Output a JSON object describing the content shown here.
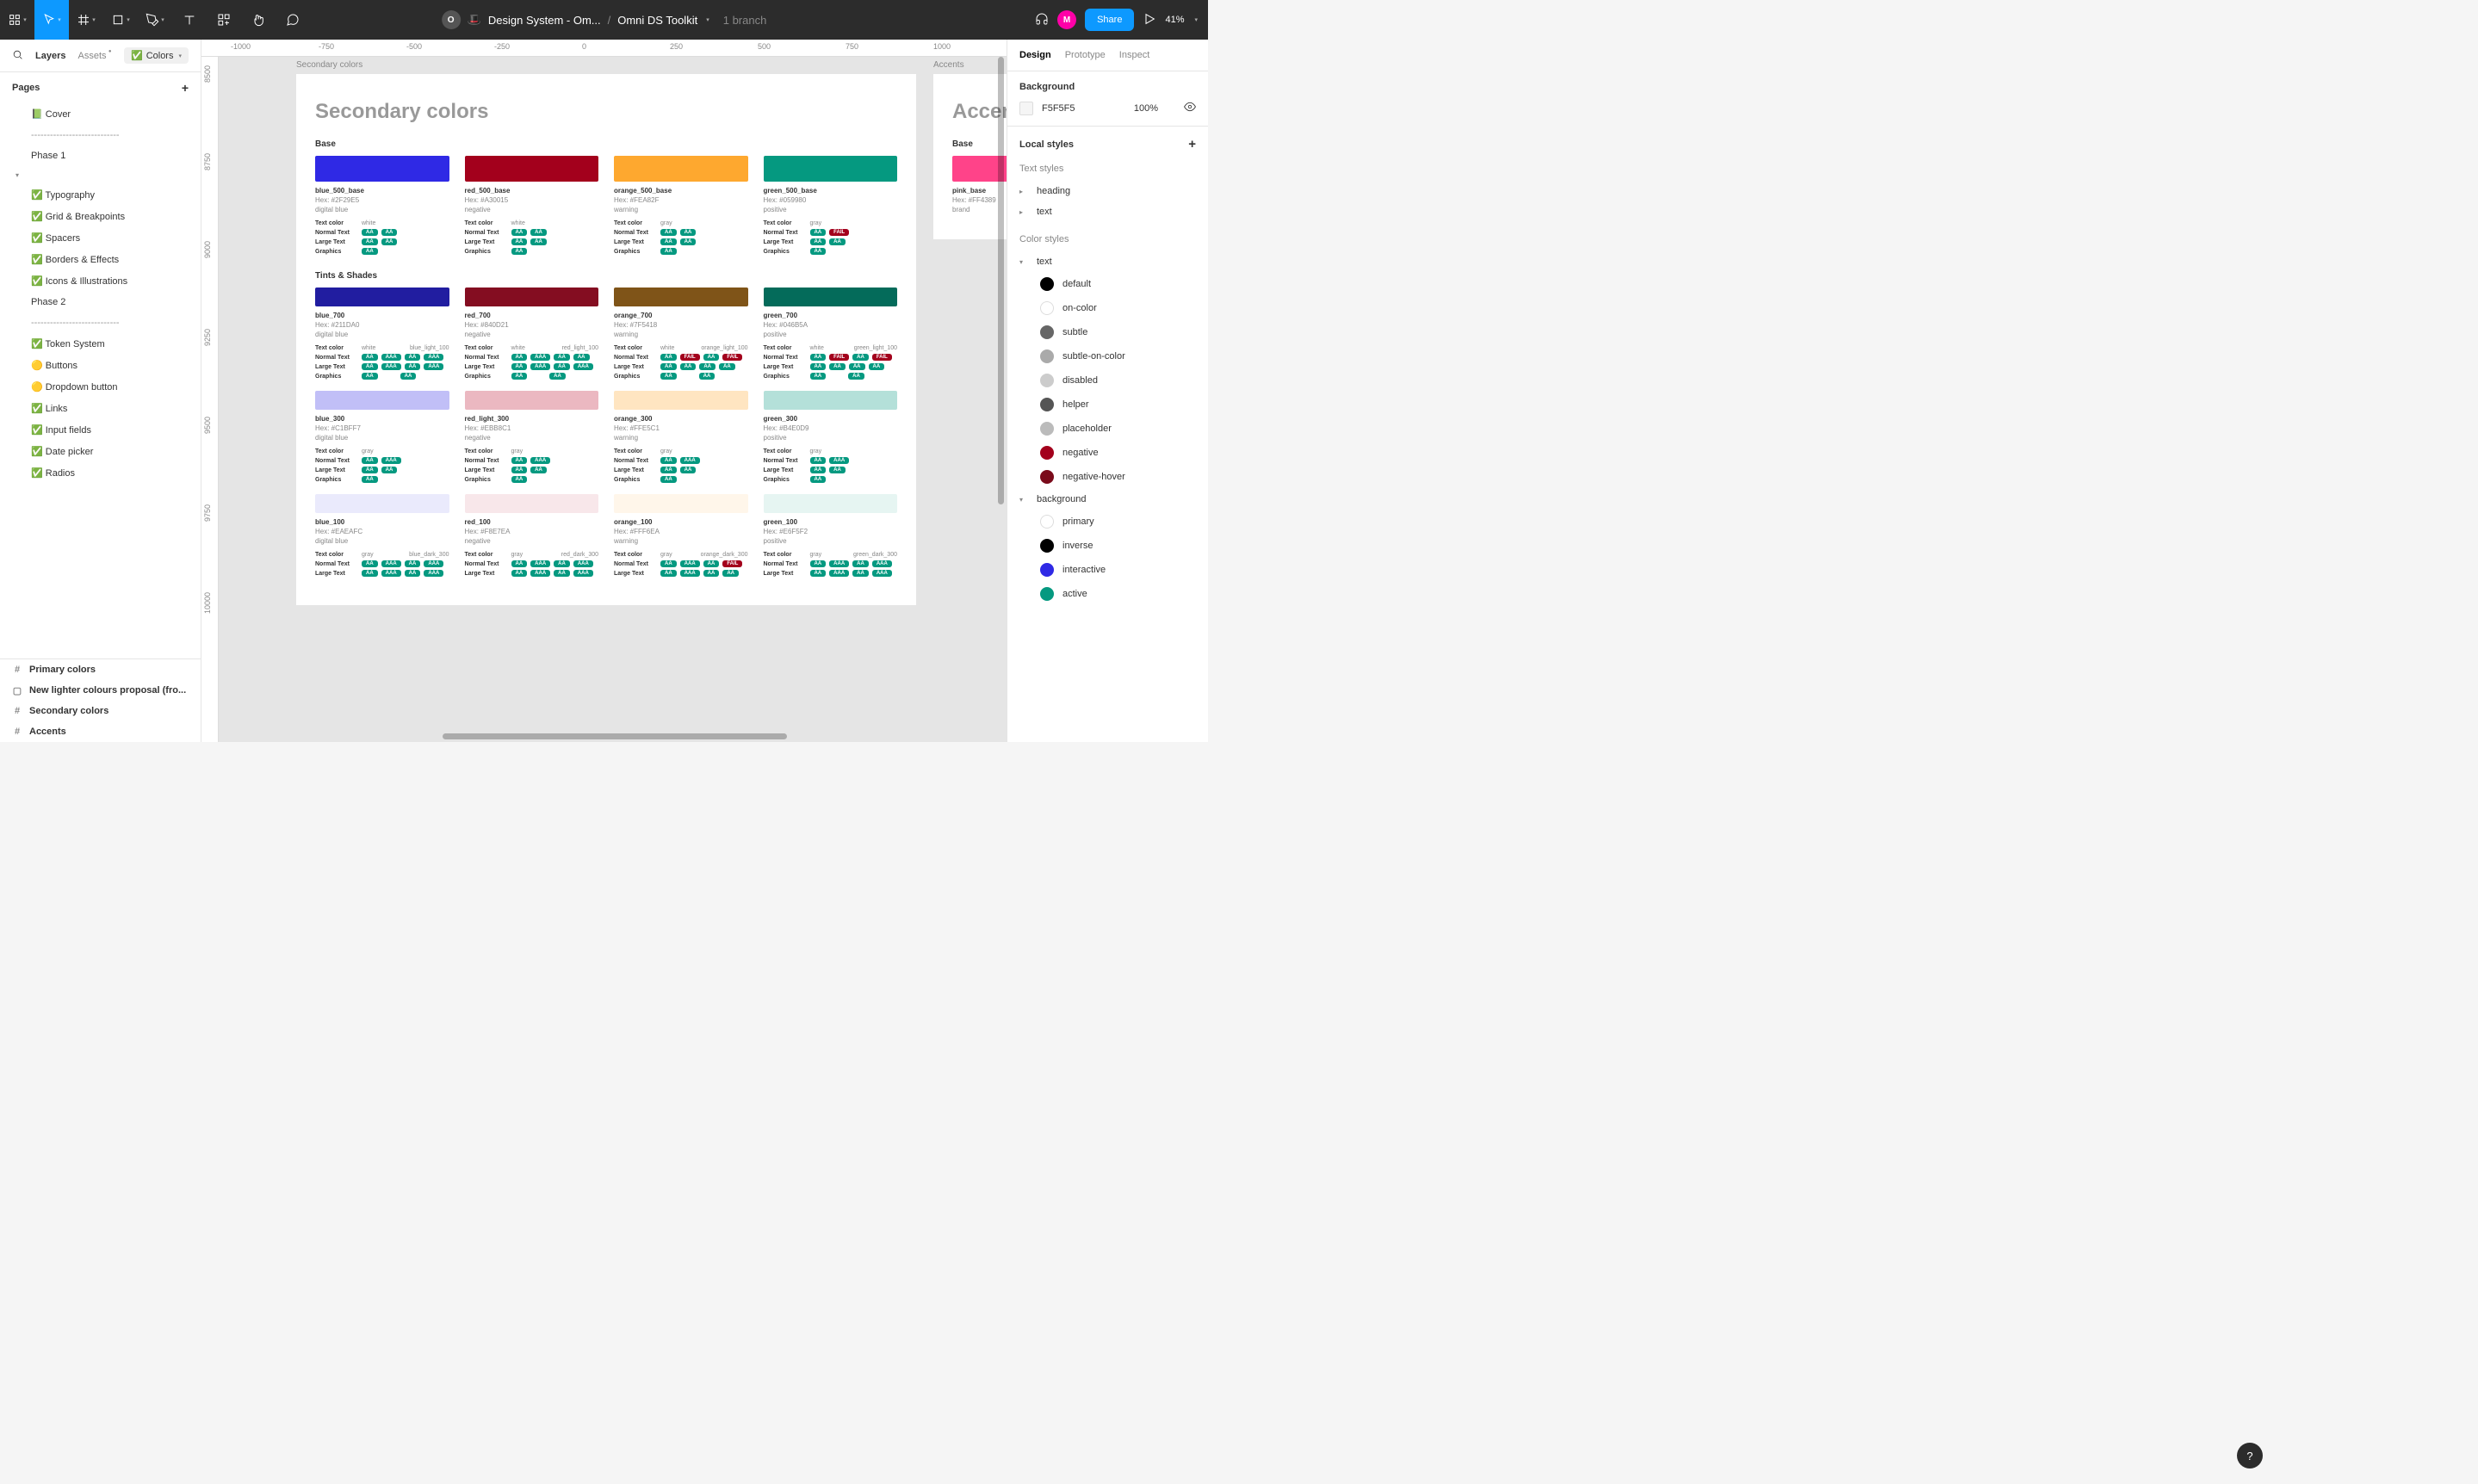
{
  "top": {
    "title": "Design System - Om...",
    "page": "Omni DS Toolkit",
    "branch": "1 branch",
    "zoom": "41%",
    "share": "Share",
    "avatar1": "O",
    "avatar2": "M"
  },
  "leftTabs": {
    "layers": "Layers",
    "assets": "Assets",
    "page": "Colors"
  },
  "pagesHeader": "Pages",
  "pages": [
    "📗 Cover",
    "----------------------------",
    "Phase 1",
    "✅ Colors",
    "✅ Typography",
    "✅ Grid & Breakpoints",
    "✅ Spacers",
    "✅ Borders & Effects",
    "✅ Icons & Illustrations",
    "Phase 2",
    "----------------------------",
    "✅ Token System",
    "🟡 Buttons",
    "🟡 Dropdown button",
    "✅ Links",
    "✅ Input fields",
    "✅ Date picker",
    "✅ Radios"
  ],
  "activePageIdx": 3,
  "leftLayers": [
    {
      "icon": "#",
      "label": "Primary colors"
    },
    {
      "icon": "▢",
      "label": "New lighter colours proposal (fro..."
    },
    {
      "icon": "#",
      "label": "Secondary colors"
    },
    {
      "icon": "#",
      "label": "Accents"
    }
  ],
  "rulerT": [
    "-1000",
    "-750",
    "-500",
    "-250",
    "0",
    "250",
    "500",
    "750",
    "1000"
  ],
  "rulerL": [
    "8500",
    "8750",
    "9000",
    "9250",
    "9500",
    "9750",
    "10000"
  ],
  "frame1Label": "Secondary colors",
  "frame2Label": "Accents",
  "h1": "Secondary colors",
  "h2": "Accents",
  "sec1": "Base",
  "sec2": "Tints & Shades",
  "base": [
    {
      "col": "#2F29E5",
      "name": "blue_500_base",
      "hex": "Hex: #2F29E5",
      "tag": "digital blue",
      "tc": "white",
      "rows": [
        [
          "Normal Text",
          "AA",
          "AA"
        ],
        [
          "Large Text",
          "AA",
          "AA"
        ],
        [
          "Graphics",
          "AA"
        ]
      ]
    },
    {
      "col": "#A3001C",
      "name": "red_500_base",
      "hex": "Hex: #A30015",
      "tag": "negative",
      "tc": "white",
      "rows": [
        [
          "Normal Text",
          "AA",
          "AA"
        ],
        [
          "Large Text",
          "AA",
          "AA"
        ],
        [
          "Graphics",
          "AA"
        ]
      ]
    },
    {
      "col": "#FEA82F",
      "name": "orange_500_base",
      "hex": "Hex: #FEA82F",
      "tag": "warning",
      "tc": "gray",
      "rows": [
        [
          "Normal Text",
          "AA",
          "AA"
        ],
        [
          "Large Text",
          "AA",
          "AA"
        ],
        [
          "Graphics",
          "AA"
        ]
      ]
    },
    {
      "col": "#059980",
      "name": "green_500_base",
      "hex": "Hex: #059980",
      "tag": "positive",
      "tc": "gray",
      "rows": [
        [
          "Normal Text",
          "AA",
          "FAIL"
        ],
        [
          "Large Text",
          "AA",
          "AA"
        ],
        [
          "Graphics",
          "AA"
        ]
      ]
    }
  ],
  "tints": [
    [
      {
        "col": "#211DA0",
        "name": "blue_700",
        "hex": "Hex: #211DA0",
        "tag": "digital blue",
        "tc": "white",
        "tc2": "blue_light_100",
        "rows": [
          [
            "Normal Text",
            "AA",
            "AAA",
            "AA",
            "AAA"
          ],
          [
            "Large Text",
            "AA",
            "AAA",
            "AA",
            "AAA"
          ],
          [
            "Graphics",
            "AA",
            "",
            "AA"
          ]
        ]
      },
      {
        "col": "#840D21",
        "name": "red_700",
        "hex": "Hex: #840D21",
        "tag": "negative",
        "tc": "white",
        "tc2": "red_light_100",
        "rows": [
          [
            "Normal Text",
            "AA",
            "AAA",
            "AA",
            "AA"
          ],
          [
            "Large Text",
            "AA",
            "AAA",
            "AA",
            "AAA"
          ],
          [
            "Graphics",
            "AA",
            "",
            "AA"
          ]
        ]
      },
      {
        "col": "#7F5418",
        "name": "orange_700",
        "hex": "Hex: #7F5418",
        "tag": "warning",
        "tc": "white",
        "tc2": "orange_light_100",
        "rows": [
          [
            "Normal Text",
            "AA",
            "FAIL",
            "AA",
            "FAIL"
          ],
          [
            "Large Text",
            "AA",
            "AA",
            "AA",
            "AA"
          ],
          [
            "Graphics",
            "AA",
            "",
            "AA"
          ]
        ]
      },
      {
        "col": "#046B5A",
        "name": "green_700",
        "hex": "Hex: #046B5A",
        "tag": "positive",
        "tc": "white",
        "tc2": "green_light_100",
        "rows": [
          [
            "Normal Text",
            "AA",
            "FAIL",
            "AA",
            "FAIL"
          ],
          [
            "Large Text",
            "AA",
            "AA",
            "AA",
            "AA"
          ],
          [
            "Graphics",
            "AA",
            "",
            "AA"
          ]
        ]
      }
    ],
    [
      {
        "col": "#C1BFF7",
        "name": "blue_300",
        "hex": "Hex: #C1BFF7",
        "tag": "digital blue",
        "tc": "gray",
        "rows": [
          [
            "Normal Text",
            "AA",
            "AAA"
          ],
          [
            "Large Text",
            "AA",
            "AA"
          ],
          [
            "Graphics",
            "AA"
          ]
        ]
      },
      {
        "col": "#EBB8C1",
        "name": "red_light_300",
        "hex": "Hex: #EBB8C1",
        "tag": "negative",
        "tc": "gray",
        "rows": [
          [
            "Normal Text",
            "AA",
            "AAA"
          ],
          [
            "Large Text",
            "AA",
            "AA"
          ],
          [
            "Graphics",
            "AA"
          ]
        ]
      },
      {
        "col": "#FFE5C1",
        "name": "orange_300",
        "hex": "Hex: #FFE5C1",
        "tag": "warning",
        "tc": "gray",
        "rows": [
          [
            "Normal Text",
            "AA",
            "AAA"
          ],
          [
            "Large Text",
            "AA",
            "AA"
          ],
          [
            "Graphics",
            "AA"
          ]
        ]
      },
      {
        "col": "#B4E0D9",
        "name": "green_300",
        "hex": "Hex: #B4E0D9",
        "tag": "positive",
        "tc": "gray",
        "rows": [
          [
            "Normal Text",
            "AA",
            "AAA"
          ],
          [
            "Large Text",
            "AA",
            "AA"
          ],
          [
            "Graphics",
            "AA"
          ]
        ]
      }
    ],
    [
      {
        "col": "#EAEAFC",
        "name": "blue_100",
        "hex": "Hex: #EAEAFC",
        "tag": "digital blue",
        "tc": "gray",
        "tc2": "blue_dark_300",
        "rows": [
          [
            "Normal Text",
            "AA",
            "AAA",
            "AA",
            "AAA"
          ],
          [
            "Large Text",
            "AA",
            "AAA",
            "AA",
            "AAA"
          ]
        ]
      },
      {
        "col": "#F8E7EA",
        "name": "red_100",
        "hex": "Hex: #F8E7EA",
        "tag": "negative",
        "tc": "gray",
        "tc2": "red_dark_300",
        "rows": [
          [
            "Normal Text",
            "AA",
            "AAA",
            "AA",
            "AAA"
          ],
          [
            "Large Text",
            "AA",
            "AAA",
            "AA",
            "AAA"
          ]
        ]
      },
      {
        "col": "#FFF6EA",
        "name": "orange_100",
        "hex": "Hex: #FFF6EA",
        "tag": "warning",
        "tc": "gray",
        "tc2": "orange_dark_300",
        "rows": [
          [
            "Normal Text",
            "AA",
            "AAA",
            "AA",
            "FAIL"
          ],
          [
            "Large Text",
            "AA",
            "AAA",
            "AA",
            "AA"
          ]
        ]
      },
      {
        "col": "#E6F5F2",
        "name": "green_100",
        "hex": "Hex: #E6F5F2",
        "tag": "positive",
        "tc": "gray",
        "tc2": "green_dark_300",
        "rows": [
          [
            "Normal Text",
            "AA",
            "AAA",
            "AA",
            "AAA"
          ],
          [
            "Large Text",
            "AA",
            "AAA",
            "AA",
            "AAA"
          ]
        ]
      }
    ]
  ],
  "accent": {
    "col": "#FF4389",
    "name": "pink_base",
    "hex": "Hex: #FF4389",
    "tag": "brand"
  },
  "rightTabs": [
    "Design",
    "Prototype",
    "Inspect"
  ],
  "background": {
    "label": "Background",
    "hex": "F5F5F5",
    "op": "100%"
  },
  "localStyles": "Local styles",
  "textStylesH": "Text styles",
  "textStyles": [
    "heading",
    "text"
  ],
  "colorStylesH": "Color styles",
  "colorStyles": {
    "text": [
      {
        "c": "#000",
        "l": "default"
      },
      {
        "c": "#fff",
        "l": "on-color",
        "b": 1
      },
      {
        "c": "#666",
        "l": "subtle"
      },
      {
        "c": "#aaa",
        "l": "subtle-on-color"
      },
      {
        "c": "#ccc",
        "l": "disabled"
      },
      {
        "c": "#555",
        "l": "helper"
      },
      {
        "c": "#bbb",
        "l": "placeholder"
      },
      {
        "c": "#A3001C",
        "l": "negative"
      },
      {
        "c": "#7a0b1b",
        "l": "negative-hover"
      }
    ],
    "background": [
      {
        "c": "#fff",
        "l": "primary",
        "b": 1
      },
      {
        "c": "#000",
        "l": "inverse"
      },
      {
        "c": "#2F29E5",
        "l": "interactive"
      },
      {
        "c": "#059980",
        "l": "active"
      }
    ]
  },
  "textColLabel": "Text color",
  "help": "?"
}
